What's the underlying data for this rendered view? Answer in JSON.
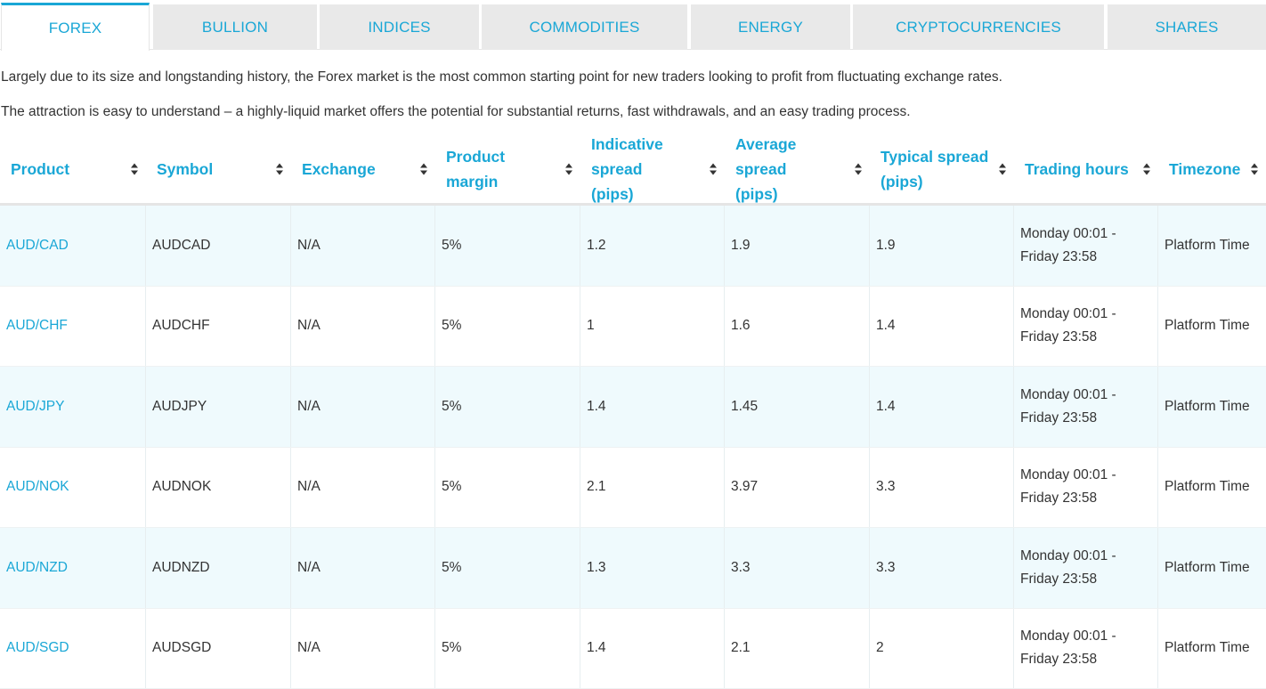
{
  "tabs": [
    {
      "label": "FOREX",
      "active": true
    },
    {
      "label": "BULLION",
      "active": false
    },
    {
      "label": "INDICES",
      "active": false
    },
    {
      "label": "COMMODITIES",
      "active": false
    },
    {
      "label": "ENERGY",
      "active": false
    },
    {
      "label": "CRYPTOCURRENCIES",
      "active": false
    },
    {
      "label": "SHARES",
      "active": false
    }
  ],
  "intro": {
    "p1": "Largely due to its size and longstanding history, the Forex market is the most common starting point for new traders looking to profit from fluctuating exchange rates.",
    "p2": "The attraction is easy to understand – a highly-liquid market offers the potential for substantial returns, fast withdrawals, and an easy trading process."
  },
  "table": {
    "headers": [
      {
        "l1": "Product",
        "l2": ""
      },
      {
        "l1": "Symbol",
        "l2": ""
      },
      {
        "l1": "Exchange",
        "l2": ""
      },
      {
        "l1": "Product margin",
        "l2": ""
      },
      {
        "l1": "Indicative spread",
        "l2": "(pips)"
      },
      {
        "l1": "Average spread",
        "l2": "(pips)"
      },
      {
        "l1": "Typical spread",
        "l2": "(pips)"
      },
      {
        "l1": "Trading hours",
        "l2": ""
      },
      {
        "l1": "Timezone",
        "l2": ""
      }
    ],
    "rows": [
      {
        "product": "AUD/CAD",
        "symbol": "AUDCAD",
        "exchange": "N/A",
        "margin": "5%",
        "indicative": "1.2",
        "average": "1.9",
        "typical": "1.9",
        "hours_1": "Monday 00:01 -",
        "hours_2": "Friday 23:58",
        "timezone": "Platform Time"
      },
      {
        "product": "AUD/CHF",
        "symbol": "AUDCHF",
        "exchange": "N/A",
        "margin": "5%",
        "indicative": "1",
        "average": "1.6",
        "typical": "1.4",
        "hours_1": "Monday 00:01 -",
        "hours_2": "Friday 23:58",
        "timezone": "Platform Time"
      },
      {
        "product": "AUD/JPY",
        "symbol": "AUDJPY",
        "exchange": "N/A",
        "margin": "5%",
        "indicative": "1.4",
        "average": "1.45",
        "typical": "1.4",
        "hours_1": "Monday 00:01 -",
        "hours_2": "Friday 23:58",
        "timezone": "Platform Time"
      },
      {
        "product": "AUD/NOK",
        "symbol": "AUDNOK",
        "exchange": "N/A",
        "margin": "5%",
        "indicative": "2.1",
        "average": "3.97",
        "typical": "3.3",
        "hours_1": "Monday 00:01 -",
        "hours_2": "Friday 23:58",
        "timezone": "Platform Time"
      },
      {
        "product": "AUD/NZD",
        "symbol": "AUDNZD",
        "exchange": "N/A",
        "margin": "5%",
        "indicative": "1.3",
        "average": "3.3",
        "typical": "3.3",
        "hours_1": "Monday 00:01 -",
        "hours_2": "Friday 23:58",
        "timezone": "Platform Time"
      },
      {
        "product": "AUD/SGD",
        "symbol": "AUDSGD",
        "exchange": "N/A",
        "margin": "5%",
        "indicative": "1.4",
        "average": "2.1",
        "typical": "2",
        "hours_1": "Monday 00:01 -",
        "hours_2": "Friday 23:58",
        "timezone": "Platform Time"
      }
    ]
  },
  "colors": {
    "accent": "#1aa7d6",
    "alt_row": "#effafd",
    "tab_bg": "#e9e9e9"
  }
}
